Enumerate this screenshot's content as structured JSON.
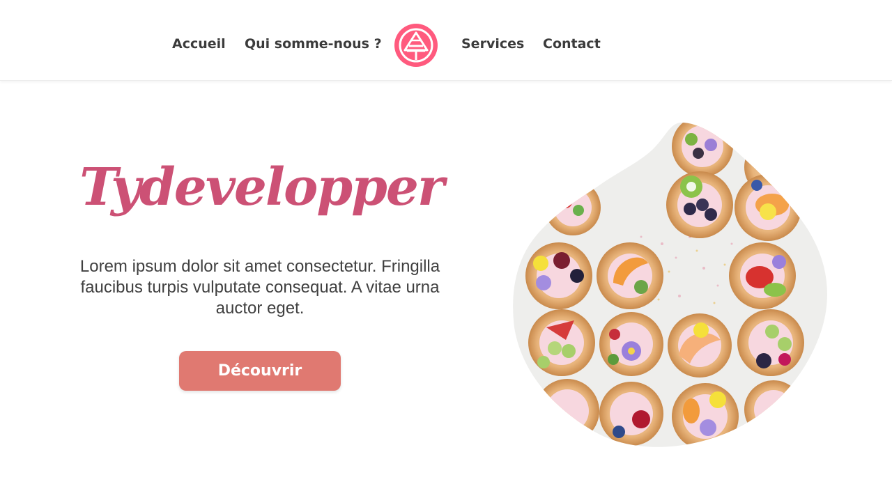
{
  "nav": {
    "items": [
      {
        "label": "Accueil"
      },
      {
        "label": "Qui somme-nous ?"
      },
      {
        "label": "Services"
      },
      {
        "label": "Contact"
      }
    ]
  },
  "hero": {
    "title": "Tydevelopper",
    "text": "Lorem ipsum dolor sit amet consectetur. Fringilla faucibus turpis vulputate consequat. A vitae urna auctor eget.",
    "button_label": "Découvrir"
  },
  "colors": {
    "brand_pink": "#cc5175",
    "logo_pink": "#ff5a7e",
    "button_coral": "#e07971",
    "nav_text": "#3b3b3b"
  },
  "icons": {
    "logo": "pink-circle-logo-icon"
  }
}
